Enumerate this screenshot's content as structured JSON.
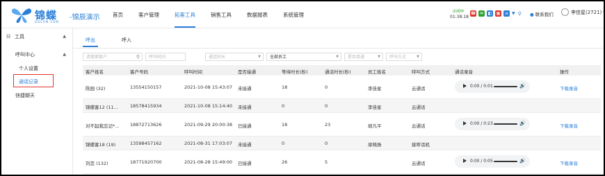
{
  "header": {
    "logo_title": "锦蝶",
    "logo_sub": "GDCRM.COM",
    "logo_product": "-锦辰演示",
    "nav": [
      "首页",
      "客户管理",
      "拓客工具",
      "销售工具",
      "数据报表",
      "系统管理"
    ],
    "active_nav": "拓客工具",
    "status_label": "示闲中",
    "status_time": "01:38:18",
    "contact": "联系我们",
    "user": "李佳星(2721)"
  },
  "sidebar": {
    "top": "工具",
    "group": "呼叫中心",
    "items": [
      "个人设置",
      "通话记录"
    ],
    "selected": "通话记录",
    "other": "快捷聊天"
  },
  "tabs": [
    "呼出",
    "呼入"
  ],
  "active_tab": "呼出",
  "filters": {
    "search_placeholder": "请搜索客户",
    "call_time": "呼叫时间",
    "call_duration": "通话时长",
    "staff": "全部员工",
    "is_connected": "是否接通",
    "call_method": "呼叫方式"
  },
  "columns": [
    "客户姓名",
    "客户号码",
    "呼叫时间",
    "是否接通",
    "等待时长(秒)",
    "通话时长(秒)",
    "员工姓名",
    "呼叫方式",
    "通话录音",
    "操作"
  ],
  "rows": [
    {
      "name": "陈园 (32)",
      "phone": "13554150157",
      "time": "2021-10-08 15:43:07",
      "connected": "未接通",
      "wait": "18",
      "talk": "0",
      "staff": "李佳星",
      "method": "云通话",
      "audio": "0:00 / 0:01",
      "action": "下载录音"
    },
    {
      "name": "锦蝶客12 (11...",
      "phone": "18578415934",
      "time": "2021-10-08 15:14:40",
      "connected": "未接通",
      "wait": "0",
      "talk": "0",
      "staff": "李佳星",
      "method": "云通话",
      "audio": "",
      "action": ""
    },
    {
      "name": "对不起我忘记*...",
      "phone": "18872713626",
      "time": "2021-09-29 20:00:38",
      "connected": "已接通",
      "wait": "18",
      "talk": "23",
      "staff": "胡凡平",
      "method": "云通话",
      "audio": "0:00 / 0:23",
      "action": "下载录音"
    },
    {
      "name": "锦蝶客18 (19)",
      "phone": "13598457162",
      "time": "2021-08-31 17:03:07",
      "connected": "未接通",
      "wait": "0",
      "talk": "0",
      "staff": "梁晓扬",
      "method": "拨呼话机",
      "audio": "",
      "action": ""
    },
    {
      "name": "刘恋 (132)",
      "phone": "18771920700",
      "time": "2021-08-28 15:49:00",
      "connected": "已接通",
      "wait": "26",
      "talk": "5",
      "staff": "",
      "method": "云通话",
      "audio": "0:00 / 0:05",
      "action": "下载录音"
    }
  ],
  "colors": {
    "accent": "#2a7fd8",
    "highlight": "#e0322b"
  }
}
